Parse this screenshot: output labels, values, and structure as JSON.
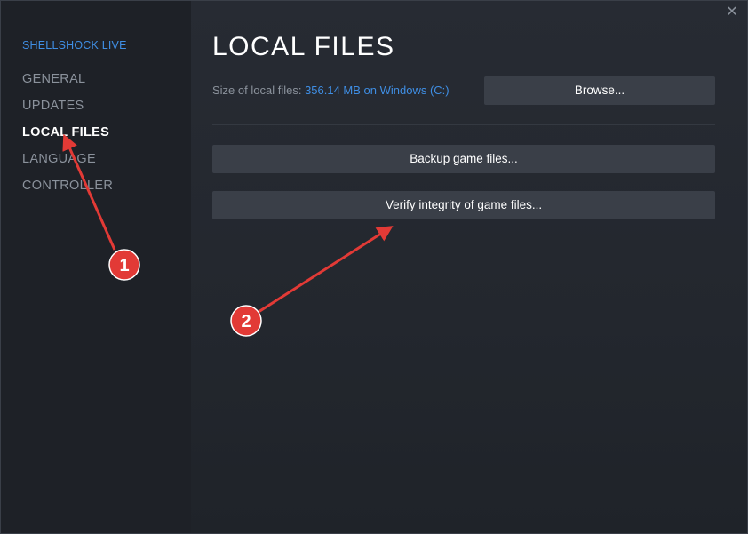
{
  "window": {
    "close_glyph": "✕"
  },
  "sidebar": {
    "game_title": "SHELLSHOCK LIVE",
    "items": [
      {
        "label": "GENERAL"
      },
      {
        "label": "UPDATES"
      },
      {
        "label": "LOCAL FILES"
      },
      {
        "label": "LANGUAGE"
      },
      {
        "label": "CONTROLLER"
      }
    ],
    "active_index": 2
  },
  "main": {
    "title": "LOCAL FILES",
    "size_label": "Size of local files:",
    "size_value": "356.14 MB on Windows (C:)",
    "browse_label": "Browse...",
    "backup_label": "Backup game files...",
    "verify_label": "Verify integrity of game files..."
  },
  "annotations": [
    {
      "number": "1"
    },
    {
      "number": "2"
    }
  ],
  "colors": {
    "accent": "#3f8ee4",
    "annotation": "#e23a36"
  }
}
